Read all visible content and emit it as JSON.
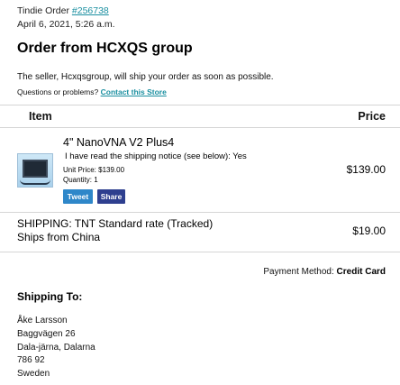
{
  "order": {
    "prefix": "Tindie Order ",
    "number": "#256738",
    "date": "April 6, 2021, 5:26 a.m."
  },
  "title": "Order from HCXQS group",
  "intro": "The seller, Hcxqsgroup, will ship your order as soon as possible.",
  "questions": {
    "text": "Questions or problems? ",
    "link": "Contact this Store"
  },
  "table": {
    "col_item": "Item",
    "col_price": "Price"
  },
  "product": {
    "name": "4\" NanoVNA V2 Plus4",
    "notice": "I have read the shipping notice (see below): Yes",
    "unit_price": "Unit Price: $139.00",
    "quantity": "Quantity: 1",
    "price": "$139.00",
    "thumbnail_icon": "nanovna-device-thumbnail"
  },
  "social": {
    "tweet": "Tweet",
    "share": "Share",
    "tweet_color": "#2e87c9",
    "share_color": "#2e3f8f"
  },
  "shipping": {
    "method": "SHIPPING: TNT Standard rate (Tracked)",
    "origin": "Ships from China",
    "price": "$19.00"
  },
  "payment": {
    "label": "Payment Method: ",
    "value": "Credit Card"
  },
  "ship_to": {
    "title": "Shipping To:",
    "name": "Åke Larsson",
    "street": "Baggvägen 26",
    "city": "Dala-järna, Dalarna",
    "postal": "786 92",
    "country": "Sweden"
  },
  "colors": {
    "link": "#1a8fa0"
  }
}
